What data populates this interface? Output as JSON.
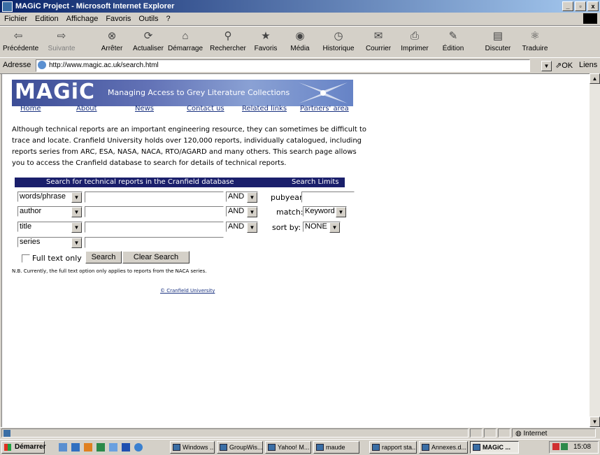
{
  "window": {
    "title": "MAGiC Project - Microsoft Internet Explorer",
    "buttons": [
      "_",
      "▫",
      "x"
    ]
  },
  "menu": [
    "Fichier",
    "Edition",
    "Affichage",
    "Favoris",
    "Outils",
    "?"
  ],
  "toolbar": {
    "back": "Précédente",
    "forward": "Suivante",
    "stop": "Arrêter",
    "refresh": "Actualiser",
    "home": "Démarrage",
    "search": "Rechercher",
    "favorites": "Favoris",
    "media": "Média",
    "history": "Historique",
    "mail": "Courrier",
    "print": "Imprimer",
    "edit": "Édition",
    "discuss": "Discuter",
    "translate": "Traduire"
  },
  "address": {
    "label": "Adresse",
    "url": "http://www.magic.ac.uk/search.html",
    "go": "OK",
    "links": "Liens"
  },
  "page": {
    "logo": "MAGiC",
    "tagline": "Managing Access to Grey Literature Collections",
    "nav": [
      "Home",
      "About",
      "News",
      "Contact us",
      "Related links",
      "Partners' area"
    ],
    "intro": "Although technical reports are an important engineering resource, they can sometimes be difficult to trace and locate. Cranfield University holds over 120,000 reports, individually catalogued, including reports series from ARC, ESA, NASA, NACA, RTO/AGARD and many others. This search page allows you to access the Cranfield database to search for details of technical reports.",
    "search_heading": "Search for technical reports in the Cranfield database",
    "limits_heading": "Search Limits",
    "fields": [
      {
        "field": "words/phrase",
        "op": "AND"
      },
      {
        "field": "author",
        "op": "AND"
      },
      {
        "field": "title",
        "op": "AND"
      },
      {
        "field": "series"
      }
    ],
    "limits": {
      "pubyear_label": "pubyear:",
      "match_label": "match:",
      "match_value": "Keyword",
      "sort_label": "sort by:",
      "sort_value": "NONE"
    },
    "fulltext_label": "Full text only",
    "search_button": "Search",
    "clear_button": "Clear Search",
    "note": "N.B. Currently, the full text option only applies to reports from the NACA series.",
    "copyright": "© Cranfield University"
  },
  "status": {
    "zone": "Internet"
  },
  "taskbar": {
    "start": "Démarrer",
    "tasks": [
      "Windows ...",
      "GroupWis...",
      "Yahoo! M...",
      "maude",
      "rapport sta...",
      "Annexes.d...",
      "MAGiC ..."
    ],
    "clock": "15:08"
  }
}
